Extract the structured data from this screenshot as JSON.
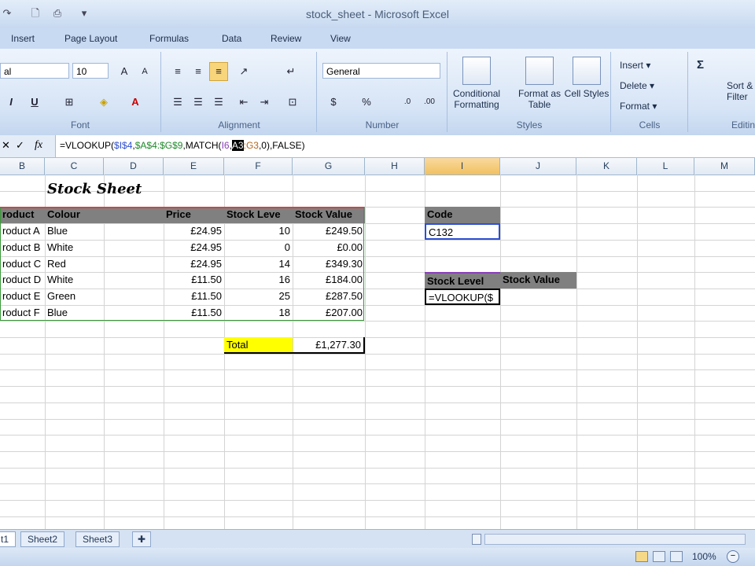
{
  "window": {
    "title": "stock_sheet - Microsoft Excel"
  },
  "menu": {
    "tabs": [
      "Insert",
      "Page Layout",
      "Formulas",
      "Data",
      "Review",
      "View"
    ]
  },
  "ribbon": {
    "font": {
      "name": "al",
      "size": "10",
      "group_label": "Font"
    },
    "alignment": {
      "group_label": "Alignment"
    },
    "number": {
      "format": "General",
      "group_label": "Number",
      "percent": "%"
    },
    "styles": {
      "conditional": "Conditional Formatting",
      "format_table": "Format as Table",
      "cell_styles": "Cell Styles",
      "group_label": "Styles"
    },
    "cells": {
      "insert": "Insert",
      "delete": "Delete",
      "format": "Format",
      "group_label": "Cells"
    },
    "editing": {
      "sum": "Σ",
      "sort": "Sort &",
      "filter": "Filter",
      "group_label": "Editin"
    }
  },
  "formula_bar": {
    "fx": "fx",
    "parts": [
      {
        "text": "=VLOOKUP(",
        "color": "#000000"
      },
      {
        "text": "$I$4",
        "color": "#2e4fd0"
      },
      {
        "text": ",",
        "color": "#000000"
      },
      {
        "text": "$A$4:$G$9",
        "color": "#1e8a2a"
      },
      {
        "text": ",MATCH(",
        "color": "#000000"
      },
      {
        "text": "I6",
        "color": "#8a3fb8"
      },
      {
        "text": ",",
        "color": "#000000"
      },
      {
        "text": "A3",
        "color": "#ffffff",
        "bg": "#000000"
      },
      {
        "text": ":G3",
        "color": "#b5651d"
      },
      {
        "text": ",0),FALSE)",
        "color": "#000000"
      }
    ]
  },
  "columns": [
    "B",
    "C",
    "D",
    "E",
    "F",
    "G",
    "H",
    "I",
    "J",
    "K",
    "L",
    "M"
  ],
  "sheet": {
    "title": "Stock Sheet",
    "headers": [
      "roduct",
      "Colour",
      "",
      "Price",
      "Stock Leve",
      "Stock Value"
    ],
    "rows": [
      [
        "roduct A",
        "Blue",
        "",
        "£24.95",
        "10",
        "£249.50"
      ],
      [
        "roduct B",
        "White",
        "",
        "£24.95",
        "0",
        "£0.00"
      ],
      [
        "roduct C",
        "Red",
        "",
        "£24.95",
        "14",
        "£349.30"
      ],
      [
        "roduct D",
        "White",
        "",
        "£11.50",
        "16",
        "£184.00"
      ],
      [
        "roduct E",
        "Green",
        "",
        "£11.50",
        "25",
        "£287.50"
      ],
      [
        "roduct F",
        "Blue",
        "",
        "£11.50",
        "18",
        "£207.00"
      ]
    ],
    "total_label": "Total",
    "total_value": "£1,277.30",
    "code_header": "Code",
    "code_value": "C132",
    "lookup_headers": [
      "Stock Level",
      "Stock Value"
    ],
    "editing_text": "=VLOOKUP($"
  },
  "sheet_tabs": [
    "t1",
    "Sheet2",
    "Sheet3"
  ],
  "status": {
    "zoom": "100%"
  },
  "colors": {
    "accent": "#c8daf1",
    "header_gray": "#808080",
    "total_yellow": "#ffff00"
  }
}
